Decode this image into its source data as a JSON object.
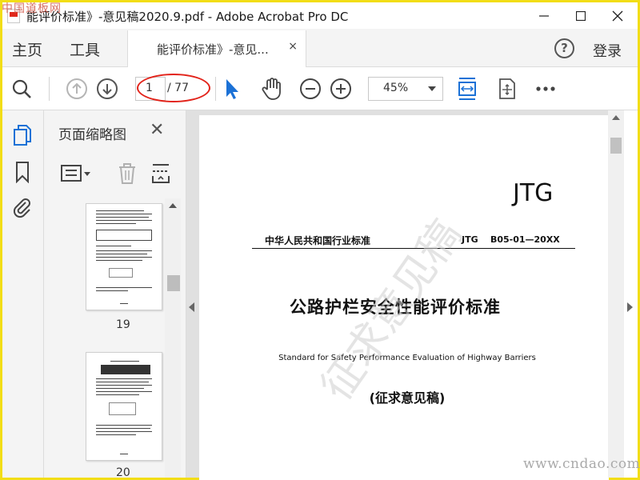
{
  "window": {
    "title": "能评价标准》-意见稿2020.9.pdf - Adobe Acrobat Pro DC",
    "minimize_icon": "minimize-icon",
    "maximize_icon": "maximize-icon",
    "close_icon": "close-icon"
  },
  "tabs": {
    "home": "主页",
    "tools": "工具",
    "document": "能评价标准》-意见...",
    "document_close": "×",
    "help": "?",
    "sign_in": "登录"
  },
  "toolbar": {
    "current_page": "1",
    "total_pages": "/ 77",
    "zoom": "45%",
    "icons": [
      "search-icon",
      "page-up-icon",
      "page-down-icon",
      "select-cursor-icon",
      "hand-tool-icon",
      "zoom-out-icon",
      "zoom-in-icon",
      "fit-width-icon",
      "full-screen-icon",
      "more-icon"
    ],
    "accent": "#1b71d6",
    "highlight": "#e2231a"
  },
  "sidebar": {
    "panel_title": "页面缩略图",
    "close": "✕",
    "thumbnails": [
      {
        "page": "19"
      },
      {
        "page": "20"
      }
    ]
  },
  "document": {
    "code_mark": "JTG",
    "industry_standard": "中华人民共和国行业标准",
    "standard_code": "JTG    B05-01—20XX",
    "title_cn": "公路护栏安全性能评价标准",
    "title_en": "Standard for Safety Performance Evaluation of Highway Barriers",
    "draft_label": "(征求意见稿)"
  },
  "watermarks": {
    "top_left": "中国道板网",
    "bottom_right": "www.cndao.com",
    "diagonal": "征求意见稿"
  }
}
